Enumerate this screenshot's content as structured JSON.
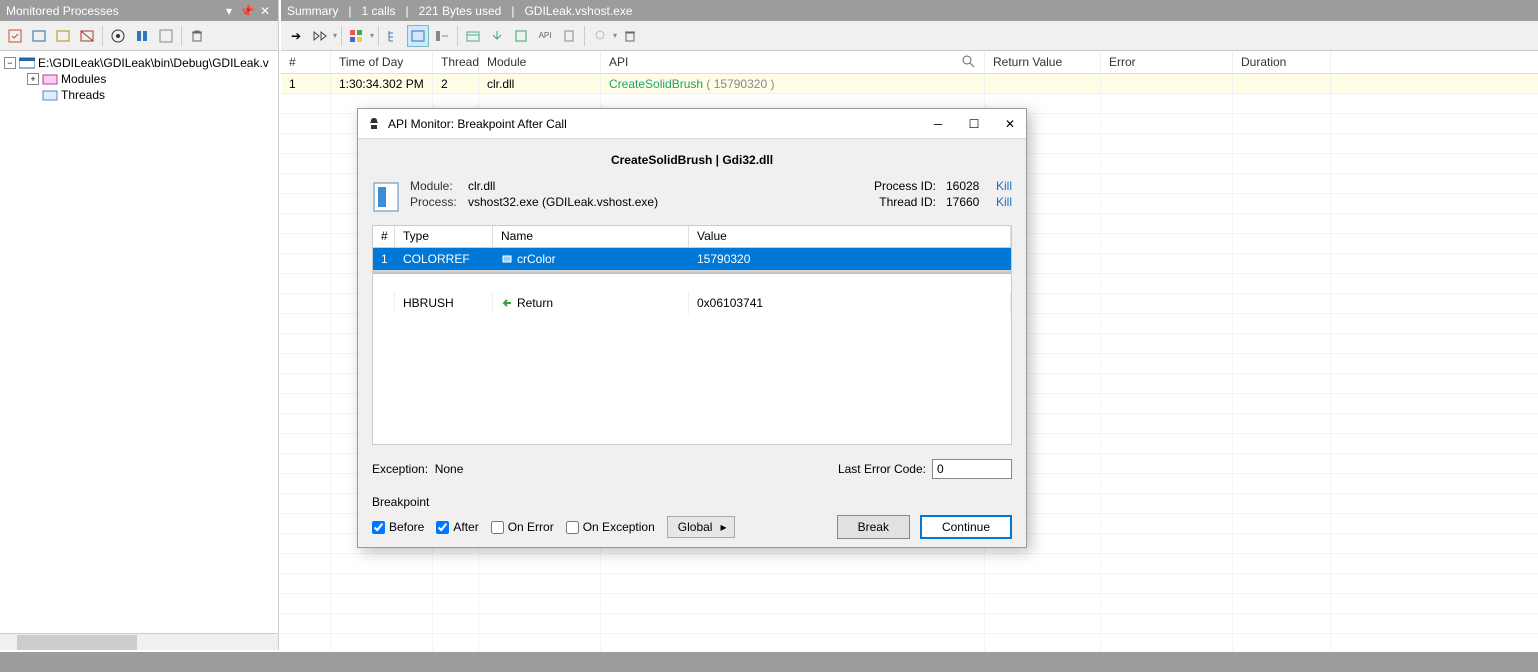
{
  "left_panel": {
    "title": "Monitored Processes",
    "tree": {
      "root": "E:\\GDILeak\\GDILeak\\bin\\Debug\\GDILeak.v",
      "children": [
        "Modules",
        "Threads"
      ]
    }
  },
  "summary": {
    "label": "Summary",
    "calls": "1 calls",
    "bytes": "221 Bytes used",
    "exe": "GDILeak.vshost.exe"
  },
  "grid": {
    "headers": {
      "num": "#",
      "time": "Time of Day",
      "thread": "Thread",
      "module": "Module",
      "api": "API",
      "return": "Return Value",
      "error": "Error",
      "duration": "Duration"
    },
    "row1": {
      "num": "1",
      "time": "1:30:34.302 PM",
      "thread": "2",
      "module": "clr.dll",
      "api_func": "CreateSolidBrush",
      "api_args": "( 15790320 )"
    }
  },
  "dialog": {
    "title": "API Monitor: Breakpoint After Call",
    "heading": "CreateSolidBrush | Gdi32.dll",
    "info": {
      "module_label": "Module:",
      "module_value": "clr.dll",
      "process_label": "Process:",
      "process_value": "vshost32.exe (GDILeak.vshost.exe)",
      "procid_label": "Process ID:",
      "procid_value": "16028",
      "threadid_label": "Thread ID:",
      "threadid_value": "17660",
      "kill": "Kill"
    },
    "param_headers": {
      "num": "#",
      "type": "Type",
      "name": "Name",
      "value": "Value"
    },
    "params": [
      {
        "num": "1",
        "type": "COLORREF",
        "name": "crColor",
        "value": "15790320"
      }
    ],
    "return_row": {
      "type": "HBRUSH",
      "name": "Return",
      "value": "0x06103741"
    },
    "exception_label": "Exception:",
    "exception_value": "None",
    "lasterror_label": "Last Error Code:",
    "lasterror_value": "0",
    "breakpoint_label": "Breakpoint",
    "checks": {
      "before": "Before",
      "after": "After",
      "onerror": "On Error",
      "onexception": "On Exception"
    },
    "global_label": "Global",
    "break_btn": "Break",
    "continue_btn": "Continue"
  }
}
